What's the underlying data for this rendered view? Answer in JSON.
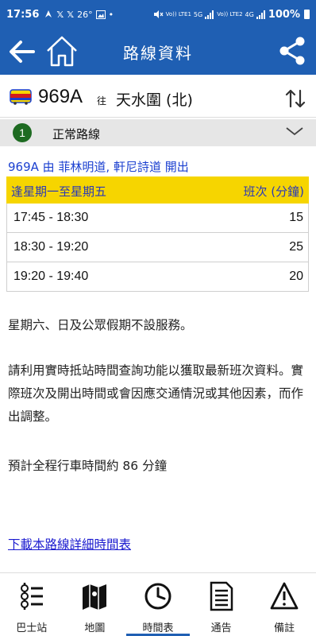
{
  "status_bar": {
    "time": "17:56",
    "temperature": "26°",
    "battery": "100%",
    "network_1": "Vo)) LTE1",
    "network_2": "5G",
    "network_3": "Vo)) LTE2",
    "network_4": "4G"
  },
  "app_bar": {
    "title": "路線資料"
  },
  "route": {
    "number": "969A",
    "toward_label": "往",
    "destination": "天水圍 (北)"
  },
  "variant": {
    "index": "1",
    "label": "正常路線"
  },
  "schedule": {
    "departure_text": "969A 由 菲林明道, 軒尼詩道 開出",
    "day_header": "逢星期一至星期五",
    "freq_header": "班次 (分鐘)",
    "rows": [
      {
        "time": "17:45 - 18:30",
        "freq": "15"
      },
      {
        "time": "18:30 - 19:20",
        "freq": "25"
      },
      {
        "time": "19:20 - 19:40",
        "freq": "20"
      }
    ]
  },
  "notes": {
    "holiday": "星期六、日及公眾假期不設服務。",
    "realtime": "請利用實時抵站時間查詢功能以獲取最新班次資料。實際班次及開出時間或會因應交通情況或其他因素，而作出調整。",
    "journey_time": "預計全程行車時間約 86 分鐘",
    "download_link": "下載本路線詳細時間表"
  },
  "bottom_nav": [
    {
      "label": "巴士站"
    },
    {
      "label": "地圖"
    },
    {
      "label": "時間表"
    },
    {
      "label": "通告"
    },
    {
      "label": "備註"
    }
  ],
  "colors": {
    "primary": "#1f5fb3",
    "header_yellow": "#f6d500",
    "variant_green": "#1e6b22",
    "link_blue": "#1a3fd0"
  }
}
